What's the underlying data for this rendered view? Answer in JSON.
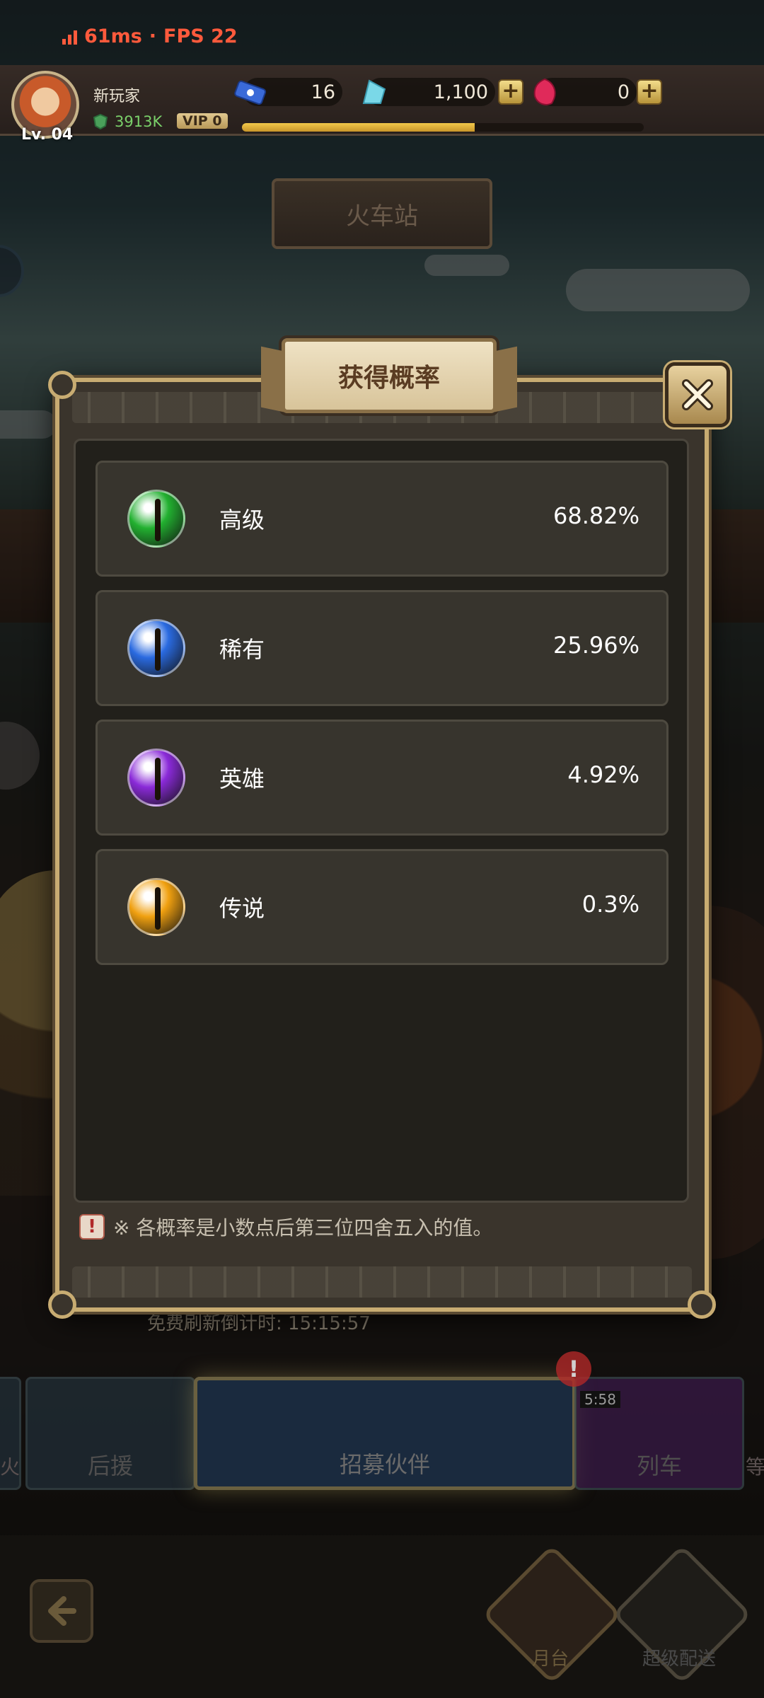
{
  "status_overlay": {
    "ping": "61ms",
    "separator": "·",
    "fps": "FPS 22"
  },
  "player": {
    "name": "新玩家",
    "level": "Lv. 04",
    "power": "3913K",
    "vip": "VIP 0",
    "xp_fraction": 0.58
  },
  "resources": {
    "tickets": "16",
    "diamonds": "1,100",
    "rubies": "0"
  },
  "location": {
    "title": "火车站"
  },
  "modal": {
    "title": "获得概率",
    "rows": [
      {
        "name": "高级",
        "pct": "68.82%",
        "color": "#22b030"
      },
      {
        "name": "稀有",
        "pct": "25.96%",
        "color": "#2a6ae0"
      },
      {
        "name": "英雄",
        "pct": "4.92%",
        "color": "#8a2ad8"
      },
      {
        "name": "传说",
        "pct": "0.3%",
        "color": "#f0a010"
      }
    ],
    "note": "※ 各概率是小数点后第三位四舍五入的值。"
  },
  "background": {
    "countdown": "免费刷新倒计时: 15:15:57",
    "recruit_label": "招募伙伴",
    "left_card_label": "后援",
    "right_card_label": "列车",
    "timer_chip": "5:58",
    "badge": "!",
    "side_left": "火",
    "side_right": "等",
    "bottom_label_1": "月台",
    "bottom_label_2": "超级配送"
  },
  "colors": {
    "accent": "#c8ac72",
    "status_red": "#ff5a3c"
  }
}
